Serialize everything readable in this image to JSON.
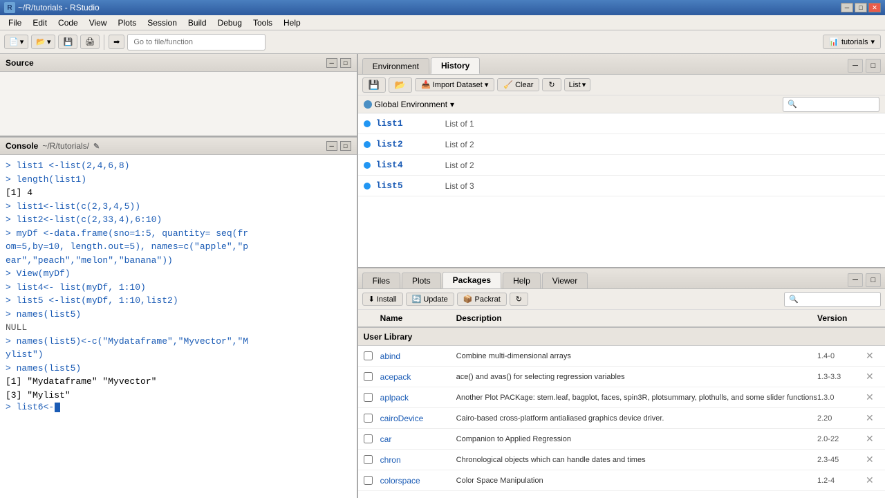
{
  "titleBar": {
    "icon": "R",
    "title": "~/R/tutorials - RStudio",
    "controls": [
      "minimize",
      "maximize",
      "close"
    ]
  },
  "menuBar": {
    "items": [
      "File",
      "Edit",
      "Code",
      "View",
      "Plots",
      "Session",
      "Build",
      "Debug",
      "Tools",
      "Help"
    ]
  },
  "toolbar": {
    "gotoPlaceholder": "Go to file/function",
    "projectLabel": "tutorials",
    "projectDropdown": "▾"
  },
  "sourcePanel": {
    "title": "Source"
  },
  "consolePanel": {
    "title": "Console",
    "path": "~/R/tutorials/",
    "lines": [
      {
        "type": "command",
        "text": "> list1 <-list(2,4,6,8)"
      },
      {
        "type": "command",
        "text": "> length(list1)"
      },
      {
        "type": "output",
        "text": "[1] 4"
      },
      {
        "type": "command",
        "text": "> list1<-list(c(2,3,4,5))"
      },
      {
        "type": "command",
        "text": "> list2<-list(c(2,33,4),6:10)"
      },
      {
        "type": "command",
        "text": "> myDf <-data.frame(sno=1:5, quantity= seq(fr"
      },
      {
        "type": "command",
        "text": "om=5,by=10, length.out=5), names=c(\"apple\",\"p"
      },
      {
        "type": "command",
        "text": "ear\",\"peach\",\"melon\",\"banana\"))"
      },
      {
        "type": "command",
        "text": "> View(myDf)"
      },
      {
        "type": "command",
        "text": "> list4<- list(myDf, 1:10)"
      },
      {
        "type": "command",
        "text": "> list5 <-list(myDf, 1:10,list2)"
      },
      {
        "type": "command",
        "text": "> names(list5)"
      },
      {
        "type": "null-output",
        "text": "NULL"
      },
      {
        "type": "command",
        "text": "> names(list5)<-c(\"Mydataframe\",\"Myvector\",\"M"
      },
      {
        "type": "command",
        "text": "ylist\")"
      },
      {
        "type": "command",
        "text": "> names(list5)"
      },
      {
        "type": "output",
        "text": "[1] \"Mydataframe\" \"Myvector\""
      },
      {
        "type": "output",
        "text": "[3] \"Mylist\""
      },
      {
        "type": "cursor",
        "text": "> list6<-"
      }
    ]
  },
  "environmentPanel": {
    "tabs": [
      {
        "label": "Environment",
        "active": false
      },
      {
        "label": "History",
        "active": true
      }
    ],
    "toolbar": {
      "saveBtn": "💾",
      "loadBtn": "📂",
      "importDataset": "Import Dataset",
      "clearBtn": "Clear",
      "refreshBtn": "↻",
      "listBtn": "List",
      "listDropdown": "▾"
    },
    "envDropdown": "Global Environment",
    "variables": [
      {
        "name": "list1",
        "value": "List of 1"
      },
      {
        "name": "list2",
        "value": "List of 2"
      },
      {
        "name": "list4",
        "value": "List of 2"
      },
      {
        "name": "list5",
        "value": "List of 3"
      }
    ]
  },
  "filesPanel": {
    "tabs": [
      {
        "label": "Files",
        "active": false
      },
      {
        "label": "Plots",
        "active": false
      },
      {
        "label": "Packages",
        "active": true
      },
      {
        "label": "Help",
        "active": false
      },
      {
        "label": "Viewer",
        "active": false
      }
    ],
    "toolbar": {
      "installBtn": "Install",
      "updateBtn": "Update",
      "packratBtn": "Packrat",
      "refreshBtn": "↻"
    },
    "tableHeaders": [
      "",
      "Name",
      "Description",
      "Version",
      ""
    ],
    "userLibraryLabel": "User Library",
    "packages": [
      {
        "name": "abind",
        "desc": "Combine multi-dimensional arrays",
        "ver": "1.4-0"
      },
      {
        "name": "acepack",
        "desc": "ace() and avas() for selecting regression variables",
        "ver": "1.3-3.3"
      },
      {
        "name": "aplpack",
        "desc": "Another Plot PACKage: stem.leaf, bagplot, faces, spin3R, plotsummary, plothulls, and some slider functions",
        "ver": "1.3.0"
      },
      {
        "name": "cairoDevice",
        "desc": "Cairo-based cross-platform antialiased graphics device driver.",
        "ver": "2.20"
      },
      {
        "name": "car",
        "desc": "Companion to Applied Regression",
        "ver": "2.0-22"
      },
      {
        "name": "chron",
        "desc": "Chronological objects which can handle dates and times",
        "ver": "2.3-45"
      },
      {
        "name": "colorspace",
        "desc": "Color Space Manipulation",
        "ver": "1.2-4"
      }
    ]
  }
}
